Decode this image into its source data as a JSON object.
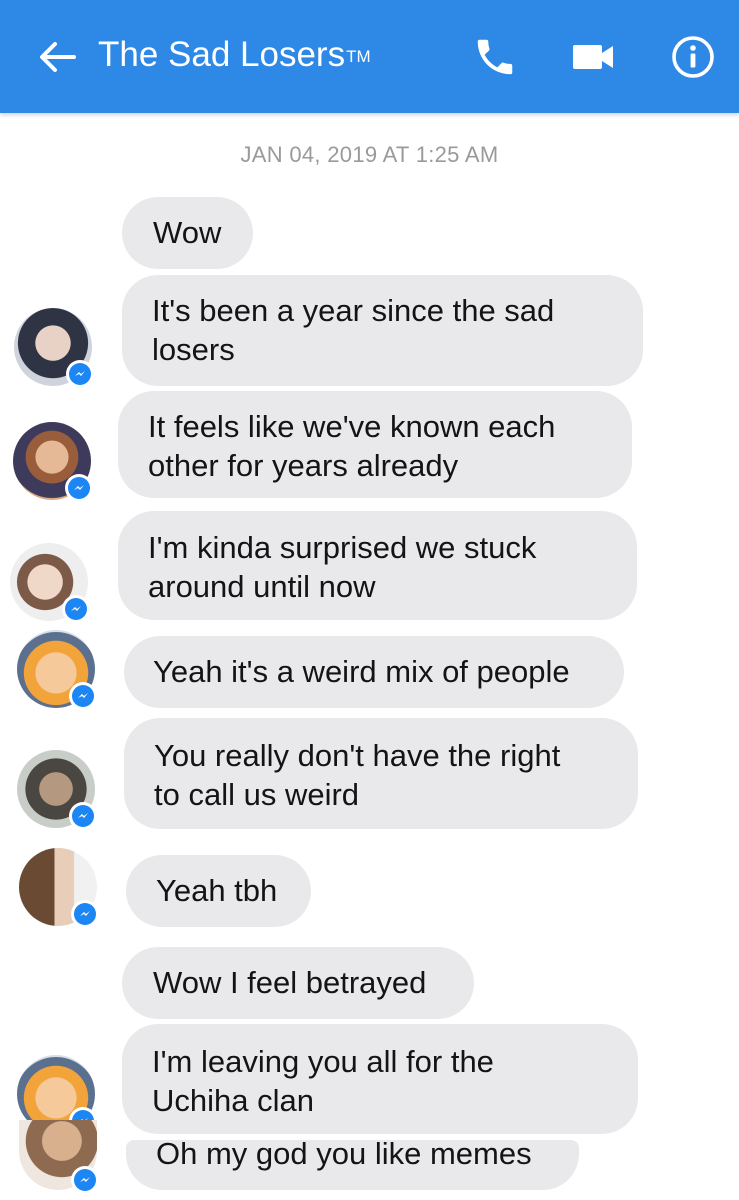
{
  "header": {
    "title": "The Sad Losers",
    "title_mark": "TM",
    "back_icon": "arrow-left-icon",
    "call_icon": "phone-icon",
    "video_icon": "video-camera-icon",
    "info_icon": "info-icon",
    "bar_color": "#2d88e6"
  },
  "timestamp": "JAN 04, 2019 AT 1:25 AM",
  "messages": [
    {
      "text": "Wow"
    },
    {
      "text": "It's been a year since the sad\nlosers"
    },
    {
      "text": "It feels like we've known each\nother for years already"
    },
    {
      "text": "I'm kinda surprised we stuck\naround until now"
    },
    {
      "text": "Yeah it's a weird mix of people"
    },
    {
      "text": "You really don't have the right\nto call us weird"
    },
    {
      "text": "Yeah tbh"
    },
    {
      "text": "Wow I feel betrayed"
    },
    {
      "text": "I'm leaving you all for the\nUchiha clan"
    },
    {
      "text": "Oh my god you like memes"
    }
  ],
  "colors": {
    "bubble": "#e9e9eb",
    "messenger_badge": "#1b86f4",
    "timestamp": "#9a9a9a"
  }
}
